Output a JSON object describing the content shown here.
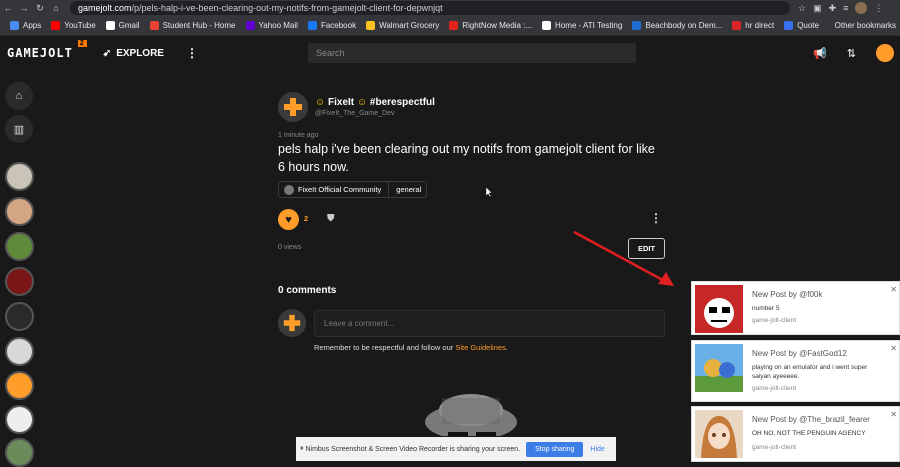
{
  "browser": {
    "url_host": "gamejolt.com",
    "url_path": "/p/pels-halp-i-ve-been-clearing-out-my-notifs-from-gamejolt-client-for-depwnjqt",
    "bookmarks": [
      {
        "label": "Apps",
        "color": "#4a8af4"
      },
      {
        "label": "YouTube",
        "color": "#ff0000"
      },
      {
        "label": "Gmail",
        "color": "#ffffff"
      },
      {
        "label": "Student Hub - Home",
        "color": "#ea4335"
      },
      {
        "label": "Yahoo Mail",
        "color": "#6001d2"
      },
      {
        "label": "Facebook",
        "color": "#1877f2"
      },
      {
        "label": "Walmart Grocery",
        "color": "#ffc220"
      },
      {
        "label": "RightNow Media :...",
        "color": "#e2231a"
      },
      {
        "label": "Home - ATI Testing",
        "color": "#ffffff"
      },
      {
        "label": "Beachbody on Dem...",
        "color": "#1f6fd1"
      },
      {
        "label": "hr direct",
        "color": "#d9252a"
      },
      {
        "label": "Quote",
        "color": "#3a6ff0"
      }
    ],
    "other_bookmarks": "Other bookmarks"
  },
  "header": {
    "logo": "GAMEJOLT",
    "logo_badge": "2",
    "explore": "EXPLORE",
    "search_placeholder": "Search"
  },
  "post": {
    "author_name": "FixeIt",
    "author_tag": "#berespectful",
    "author_handle": "@FixeIt_The_Game_Dev",
    "time": "1 minute ago",
    "text": "pels halp i've been clearing out my notifs from gamejolt client for like 6 hours now.",
    "community": "FixeIt Official Community",
    "channel": "general",
    "like_count": "2",
    "views": "0 views",
    "edit_label": "EDIT"
  },
  "comments": {
    "title": "0 comments",
    "placeholder": "Leave a comment...",
    "guideline_text": "Remember to be respectful and follow our ",
    "guideline_link": "Site Guidelines",
    "guideline_end": "."
  },
  "screen_share": {
    "message": "Nimbus Screenshot & Screen Video Recorder is sharing your screen.",
    "stop": "Stop sharing",
    "hide": "Hide"
  },
  "notifications": [
    {
      "title": "New Post by @f00k",
      "body": "number 5",
      "source": "game-jolt-client"
    },
    {
      "title": "New Post by @FastGod12",
      "body": "playing on an emulator and i went super saiyan ayeeeee.",
      "source": "game-jolt-client"
    },
    {
      "title": "New Post by @The_brazil_fearer",
      "body": "OH NO, NOT THE PENGUIN AGENCY",
      "source": "game-jolt-client"
    }
  ],
  "colors": {
    "accent": "#ff9c2a",
    "background": "#191919",
    "share_button": "#3c7de8"
  }
}
